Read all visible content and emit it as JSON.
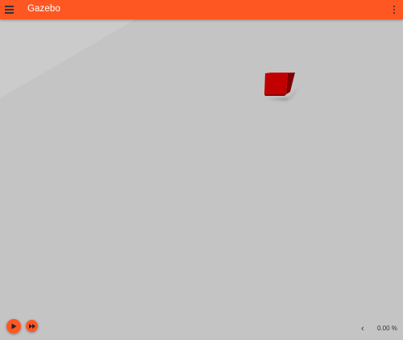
{
  "toolbar": {
    "title": "Gazebo",
    "menu_icon": "hamburger-menu-icon",
    "more_icon": "more-vert-icon",
    "color": "#ff5722"
  },
  "scene": {
    "background_color": "#c4c4c4",
    "object_color": "#c40000"
  },
  "controls": {
    "play_icon": "play-icon",
    "step_icon": "fast-forward-icon",
    "rtf_toggle_icon": "chevron-left-icon",
    "real_time_factor": "0.00 %"
  }
}
